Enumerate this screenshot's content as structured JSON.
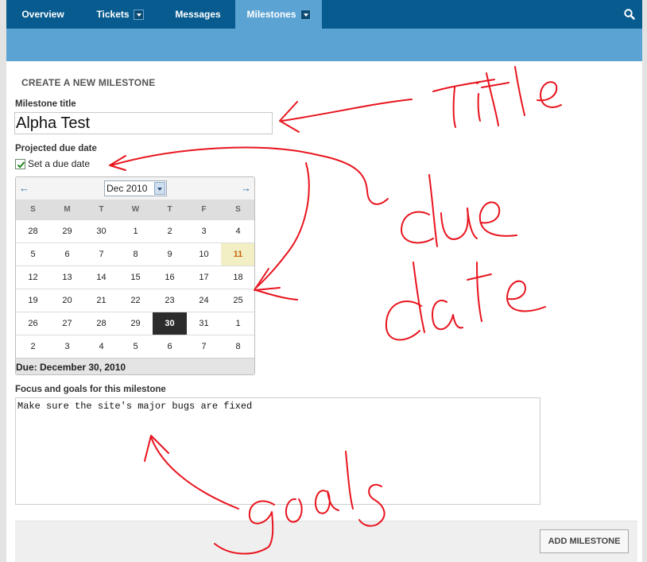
{
  "nav": {
    "tabs": [
      {
        "label": "Overview"
      },
      {
        "label": "Tickets"
      },
      {
        "label": "Messages"
      },
      {
        "label": "Milestones"
      }
    ],
    "active_tab": "Milestones",
    "search_icon": "search-icon"
  },
  "form": {
    "heading": "CREATE A NEW MILESTONE",
    "title_label": "Milestone title",
    "title_value": "Alpha Test",
    "due_label": "Projected due date",
    "due_checkbox_label": "Set a due date",
    "due_checked": true,
    "goals_label": "Focus and goals for this milestone",
    "goals_value": "Make sure the site's major bugs are fixed",
    "submit_label": "ADD MILESTONE"
  },
  "calendar": {
    "prev_arrow": "←",
    "next_arrow": "→",
    "month_select": "Dec 2010",
    "weekdays": [
      "S",
      "M",
      "T",
      "W",
      "T",
      "F",
      "S"
    ],
    "weeks": [
      [
        "28",
        "29",
        "30",
        "1",
        "2",
        "3",
        "4"
      ],
      [
        "5",
        "6",
        "7",
        "8",
        "9",
        "10",
        "11"
      ],
      [
        "12",
        "13",
        "14",
        "15",
        "16",
        "17",
        "18"
      ],
      [
        "19",
        "20",
        "21",
        "22",
        "23",
        "24",
        "25"
      ],
      [
        "26",
        "27",
        "28",
        "29",
        "30",
        "31",
        "1"
      ],
      [
        "2",
        "3",
        "4",
        "5",
        "6",
        "7",
        "8"
      ]
    ],
    "highlighted_day": "11",
    "selected_day": "30",
    "footer": "Due: December 30, 2010"
  },
  "colors": {
    "nav_bg": "#075b8f",
    "nav_active": "#5ba3d3",
    "annotation": "#e8141e"
  }
}
